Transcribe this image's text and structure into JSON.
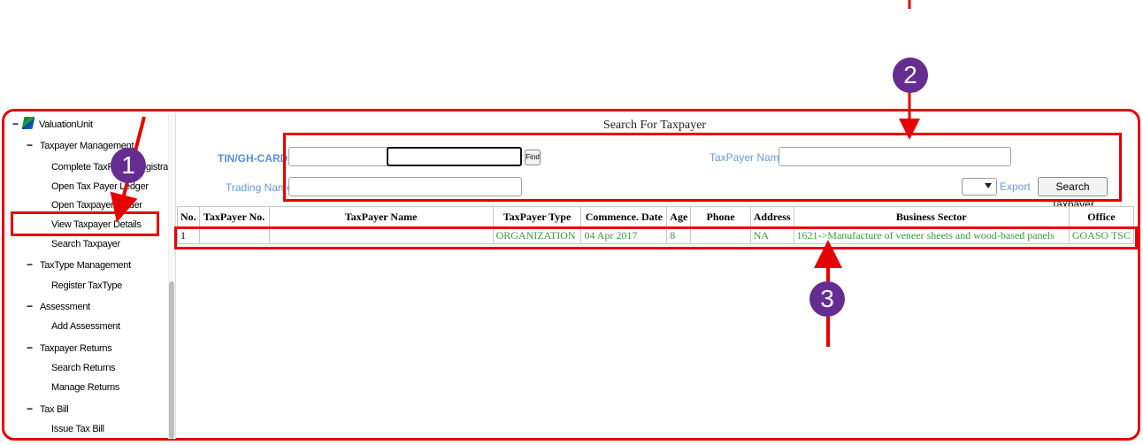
{
  "sidebar": {
    "root": {
      "toggle": "−",
      "label": "ValuationUnit"
    },
    "groups": [
      {
        "toggle": "−",
        "label": "Taxpayer Management"
      },
      {
        "toggle": "−",
        "label": "TaxType Management"
      },
      {
        "toggle": "−",
        "label": "Assessment"
      },
      {
        "toggle": "−",
        "label": "Taxpayer Returns"
      },
      {
        "toggle": "−",
        "label": "Tax Bill"
      }
    ],
    "items": [
      "Complete TaxPayer Registration",
      "Open Tax Payer Ledger",
      "Open Taxpayer Folder",
      "View Taxpayer Details",
      "Search Taxpayer",
      "Register TaxType",
      "Add Assessment",
      "Search Returns",
      "Manage Returns",
      "Issue Tax Bill"
    ]
  },
  "search": {
    "title": "Search For Taxpayer",
    "tin_label": "TIN/GH-CARD",
    "tin_value": "",
    "tin_second_value": "",
    "find_label": "Find",
    "name_label": "TaxPayer Name",
    "name_value": "",
    "trading_label": "Trading Name",
    "trading_value": "",
    "export_label": "Export",
    "search_button": "Search Taxpayer"
  },
  "table": {
    "headers": [
      "No.",
      "TaxPayer No.",
      "TaxPayer Name",
      "TaxPayer Type",
      "Commence. Date",
      "Age",
      "Phone",
      "Address",
      "Business Sector",
      "Office"
    ],
    "rows": [
      [
        "1",
        "",
        "",
        "ORGANIZATION",
        "04 Apr 2017",
        "8",
        "",
        "NA",
        "1621->Manufacture of veneer sheets and wood-based panels",
        "GOASO TSC"
      ]
    ]
  },
  "annotations": {
    "badge1": "1",
    "badge2": "2",
    "badge3": "3"
  },
  "colors": {
    "annotation_red": "#e60000",
    "badge_purple": "#662d91",
    "label_blue": "#6a9ad8",
    "row_green": "#3a9a3a"
  }
}
